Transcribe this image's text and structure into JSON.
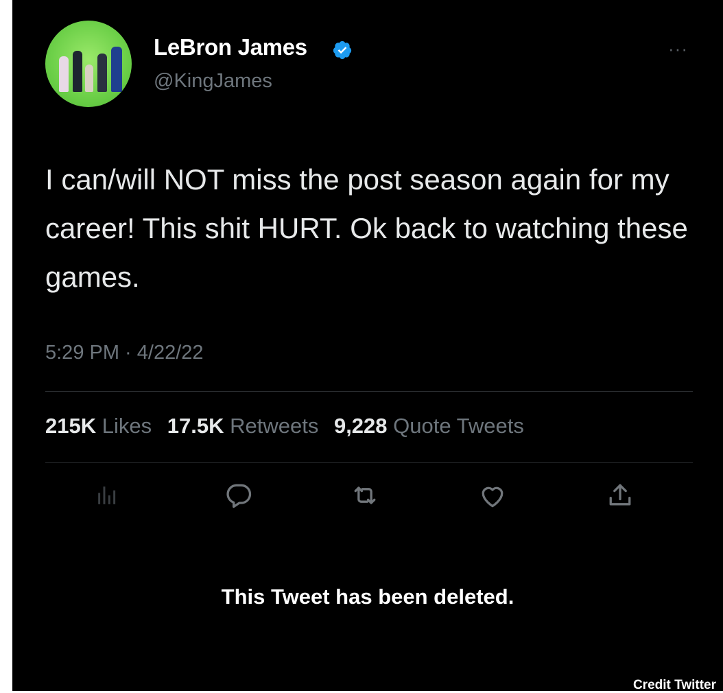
{
  "tweet": {
    "display_name": "LeBron James",
    "handle": "@KingJames",
    "text": "I can/will NOT miss the post season again for my career! This shit HURT. Ok back to watching these games.",
    "timestamp": "5:29 PM · 4/22/22",
    "stats": {
      "likes_count": "215K",
      "likes_label": "Likes",
      "retweets_count": "17.5K",
      "retweets_label": "Retweets",
      "quotes_count": "9,228",
      "quotes_label": "Quote Tweets"
    },
    "more_glyph": "···",
    "deleted_notice": "This Tweet has been deleted."
  },
  "actions": [
    {
      "icon": "analytics-icon"
    },
    {
      "icon": "reply-icon"
    },
    {
      "icon": "retweet-icon"
    },
    {
      "icon": "like-icon"
    },
    {
      "icon": "share-icon"
    }
  ],
  "credit": "Credit Twitter",
  "colors": {
    "background": "#000000",
    "primary_text": "#e7e9ea",
    "secondary_text": "#6e767d",
    "verified_badge": "#1d9bf0",
    "avatar_green": "#6fd14a"
  }
}
